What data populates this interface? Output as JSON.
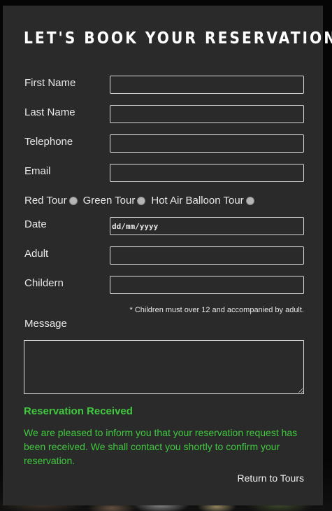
{
  "form": {
    "title": "LET'S BOOK YOUR RESERVATION!",
    "fields": {
      "first_name": "First Name",
      "last_name": "Last Name",
      "telephone": "Telephone",
      "email": "Email",
      "date": "Date",
      "date_placeholder": "dd/mm/yyyy",
      "adult": "Adult",
      "children": "Childern",
      "message": "Message"
    },
    "tours": [
      "Red Tour",
      "Green Tour",
      "Hot Air Balloon Tour"
    ],
    "children_note": "* Children must over 12 and accompanied by adult."
  },
  "status": {
    "title": "Reservation Received",
    "message": "We are pleased to inform you that your reservation request has been received. We shall contact you shortly to confirm your reservation.",
    "color": "#3fc93f"
  },
  "footer": {
    "return_link": "Return to Tours"
  }
}
